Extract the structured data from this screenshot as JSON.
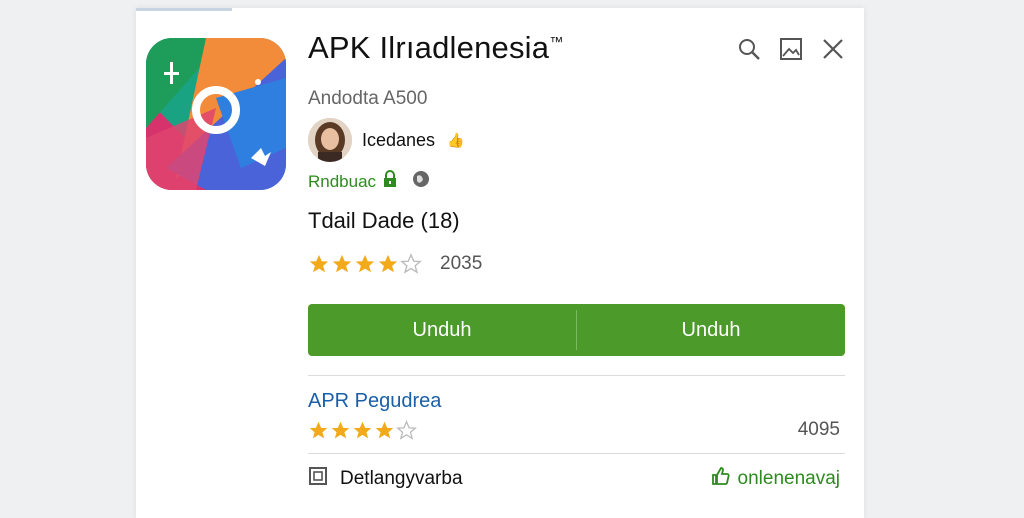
{
  "app": {
    "title": "APK Ilrıadlenesia",
    "trademark": "™",
    "subtitle": "Andodta A500",
    "developer": "Icedanes",
    "badge": "Rndbuac",
    "details": "Tdail Dade (18)",
    "rating_count": "2035",
    "rating": 4
  },
  "toolbar": {
    "search_icon": "search-icon",
    "image_icon": "image-icon",
    "close_icon": "close-icon"
  },
  "download": {
    "left_label": "Unduh",
    "right_label": "Unduh"
  },
  "related": {
    "title": "APR Pegudrea",
    "rating": 4,
    "count": "4095"
  },
  "footer": {
    "left_label": "Detlangyvarba",
    "right_label": "onlenenavaj"
  },
  "colors": {
    "accent_green": "#4c9a2a",
    "text_green": "#2e8b1f",
    "link_blue": "#1a5fa8",
    "star": "#f2a91a"
  }
}
